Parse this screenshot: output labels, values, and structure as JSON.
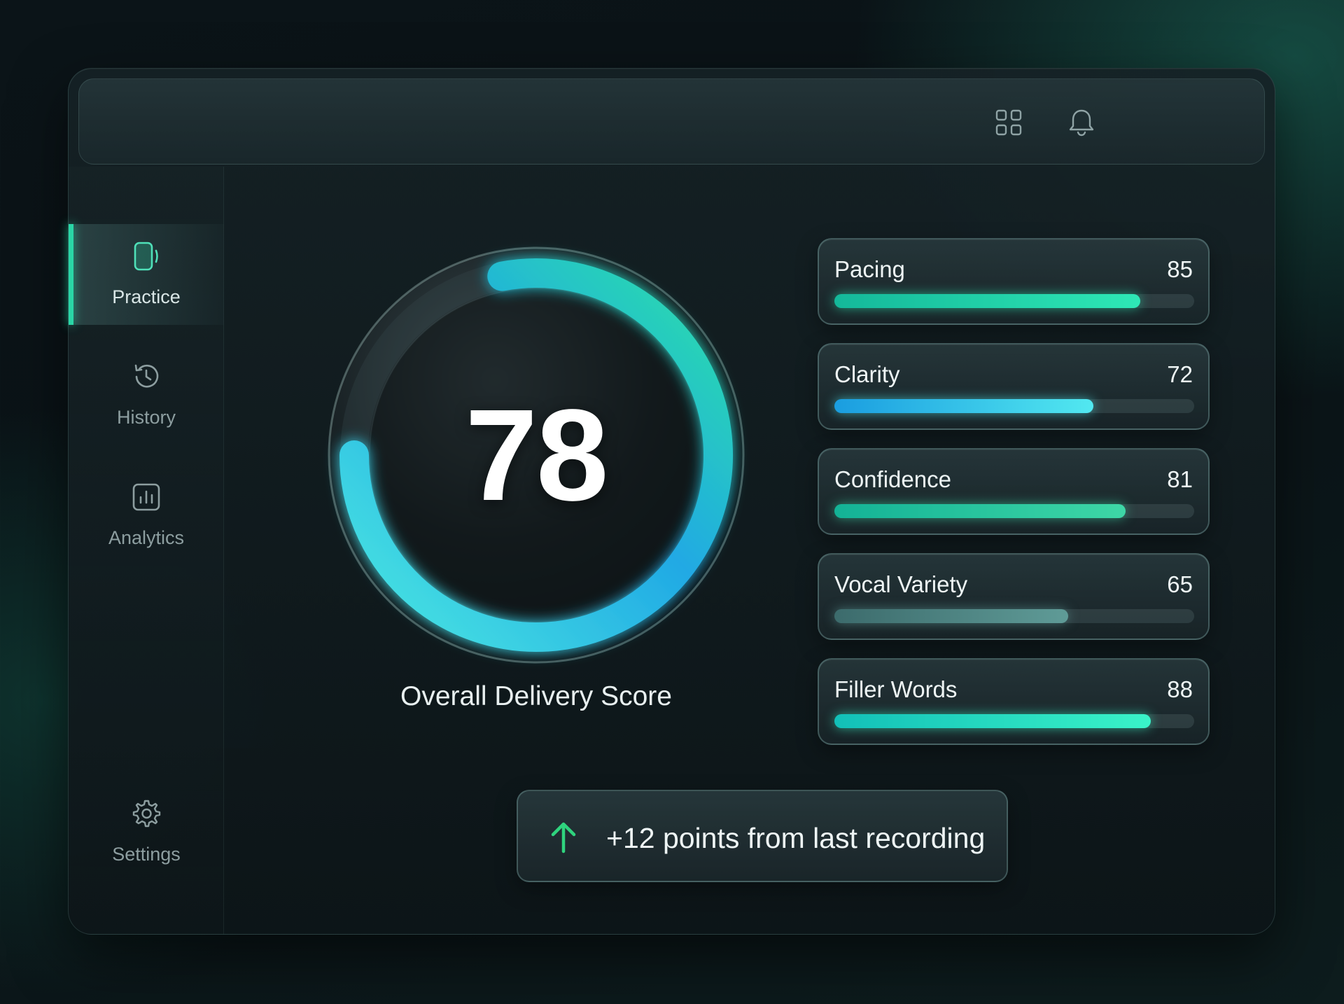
{
  "header": {
    "icons": [
      "grid-icon",
      "bell-icon"
    ]
  },
  "sidebar": {
    "items": [
      {
        "label": "Practice",
        "icon": "phone-icon",
        "active": true
      },
      {
        "label": "History",
        "icon": "history-icon",
        "active": false
      },
      {
        "label": "Analytics",
        "icon": "bar-chart-icon",
        "active": false
      }
    ],
    "settings": {
      "label": "Settings",
      "icon": "gear-icon"
    }
  },
  "score": {
    "value": "78",
    "fraction": 0.78,
    "label": "Overall Delivery Score"
  },
  "metrics": [
    {
      "name": "Pacing",
      "value": "85",
      "fraction": 0.85,
      "color_from": "#14b89a",
      "color_to": "#2ee8b6"
    },
    {
      "name": "Clarity",
      "value": "72",
      "fraction": 0.72,
      "color_from": "#1a9de0",
      "color_to": "#52e8f0"
    },
    {
      "name": "Confidence",
      "value": "81",
      "fraction": 0.81,
      "color_from": "#13b296",
      "color_to": "#3ed7a6"
    },
    {
      "name": "Vocal Variety",
      "value": "65",
      "fraction": 0.65,
      "color_from": "#3c6b6c",
      "color_to": "#5f9b97"
    },
    {
      "name": "Filler Words",
      "value": "88",
      "fraction": 0.88,
      "color_from": "#12c0b8",
      "color_to": "#3af3c8"
    }
  ],
  "delta": {
    "text": "+12 points from last recording",
    "icon": "arrow-up-icon",
    "color": "#2fd47e"
  }
}
